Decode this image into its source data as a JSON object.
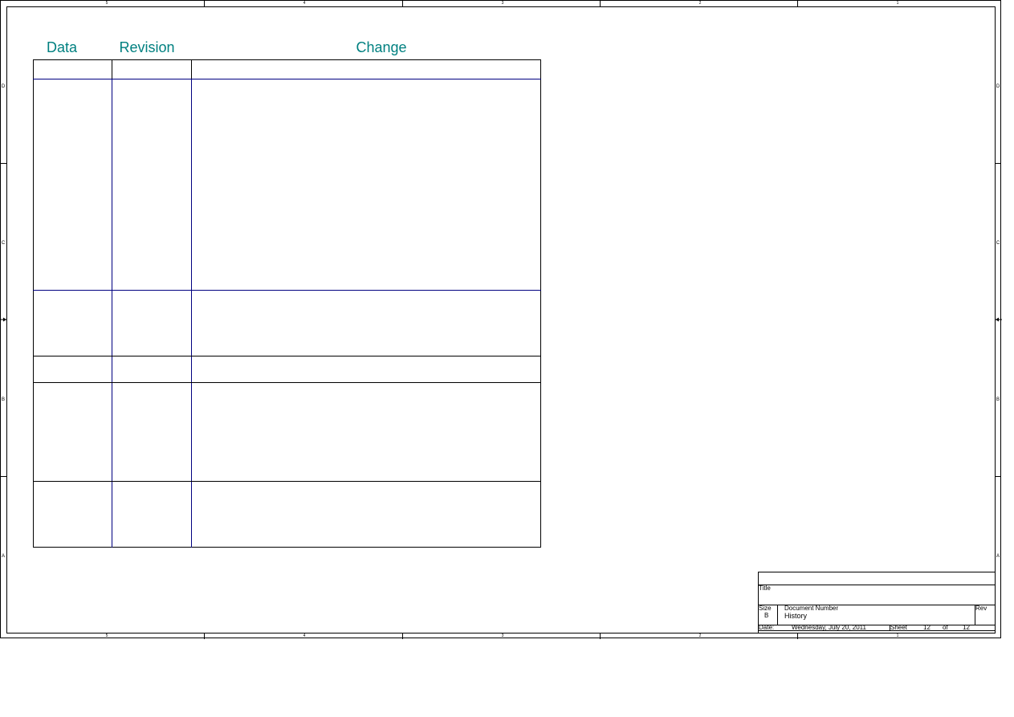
{
  "zones": {
    "columns": [
      "5",
      "4",
      "3",
      "2",
      "1"
    ],
    "rows": [
      "D",
      "C",
      "B",
      "A"
    ]
  },
  "history_table": {
    "headers": [
      "Data",
      "Revision",
      "Change"
    ],
    "header_color": "#008080",
    "rows": [
      {
        "date": "",
        "revision": "",
        "change": ""
      },
      {
        "date": "",
        "revision": "",
        "change": ""
      },
      {
        "date": "",
        "revision": "",
        "change": ""
      },
      {
        "date": "",
        "revision": "",
        "change": ""
      },
      {
        "date": "",
        "revision": "",
        "change": ""
      },
      {
        "date": "",
        "revision": "",
        "change": ""
      }
    ]
  },
  "title_block": {
    "title_label": "Title",
    "title_value": "",
    "size_label": "Size",
    "size_value": "B",
    "docnum_label": "Document Number",
    "docnum_value": "History",
    "rev_label": "Rev",
    "rev_value": "",
    "date_label": "Date:",
    "date_value": "Wednesday, July 20, 2011",
    "sheet_label": "Sheet",
    "sheet_value": "12",
    "of_label": "of",
    "of_value": "12"
  }
}
